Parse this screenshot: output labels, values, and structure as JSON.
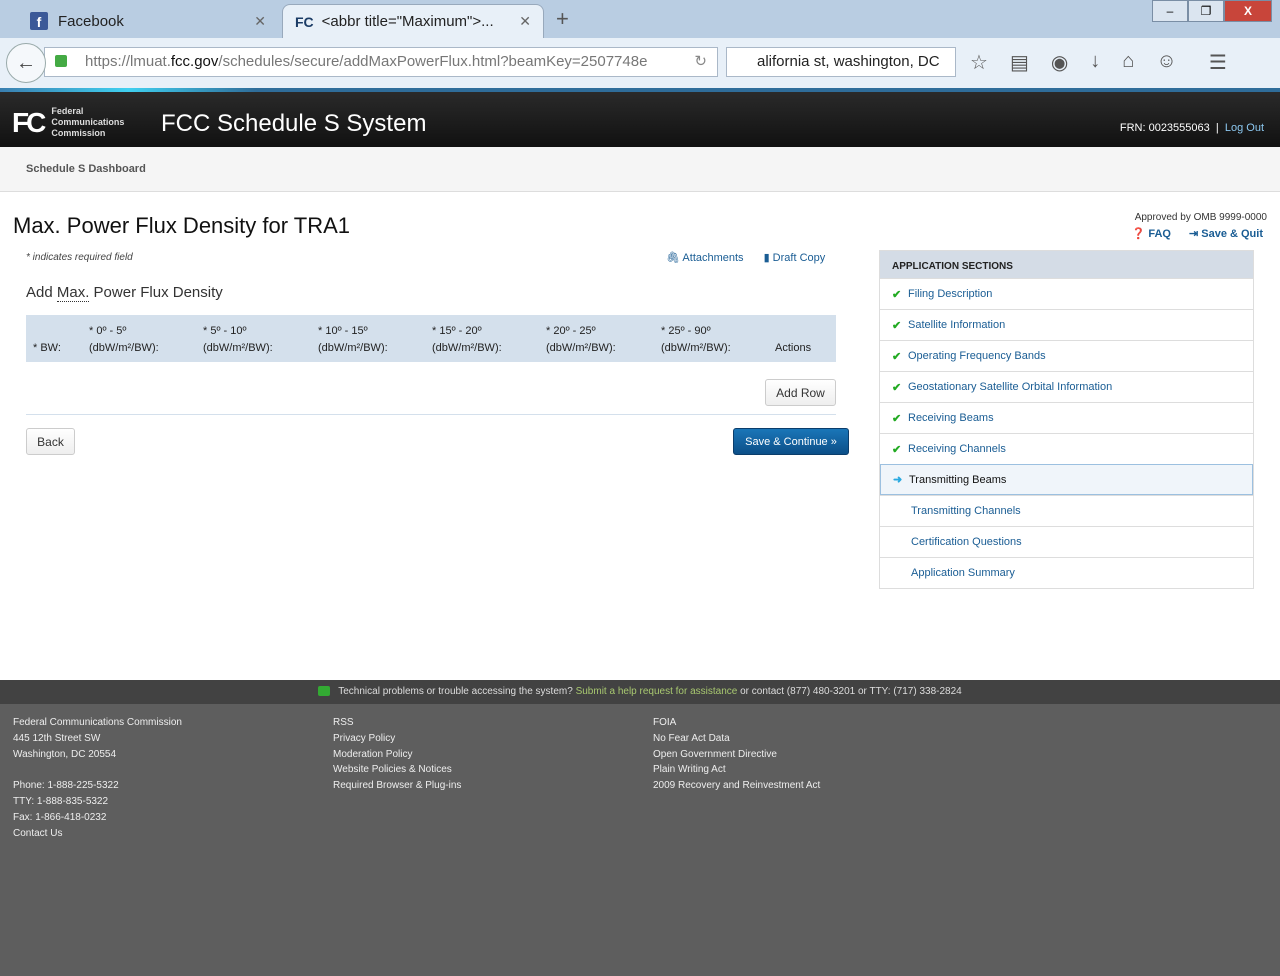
{
  "browser": {
    "tabs": [
      {
        "label": "Facebook"
      },
      {
        "label": "<abbr title=\"Maximum\">..."
      }
    ],
    "url_prefix": "https://lmuat.",
    "url_domain": "fcc.gov",
    "url_path": "/schedules/secure/addMaxPowerFlux.html?beamKey=2507748e",
    "search_value": "alifornia st, washington, DC"
  },
  "header": {
    "logo_text": "Federal Communications Commission",
    "app_title": "FCC Schedule S System",
    "frn": "FRN: 0023555063",
    "logout": "Log Out"
  },
  "subnav": {
    "dashboard": "Schedule S Dashboard"
  },
  "page": {
    "title": "Max. Power Flux Density for TRA1",
    "required_note": "* indicates required field",
    "attachments": "Attachments",
    "draft_copy": "Draft Copy",
    "section_title_abbr": "Max.",
    "section_title_rest": " Power Flux Density",
    "section_title_prefix": "Add ",
    "columns": [
      {
        "top": "",
        "bottom": "* BW:"
      },
      {
        "top": "* 0º - 5º",
        "bottom": "(dbW/m²/BW):"
      },
      {
        "top": "* 5º - 10º",
        "bottom": "(dbW/m²/BW):"
      },
      {
        "top": "* 10º - 15º",
        "bottom": "(dbW/m²/BW):"
      },
      {
        "top": "* 15º - 20º",
        "bottom": "(dbW/m²/BW):"
      },
      {
        "top": "* 20º - 25º",
        "bottom": "(dbW/m²/BW):"
      },
      {
        "top": "* 25º - 90º",
        "bottom": "(dbW/m²/BW):"
      },
      {
        "top": "",
        "bottom": "Actions"
      }
    ],
    "add_row": "Add Row",
    "back": "Back",
    "save_continue": "Save & Continue »"
  },
  "sidebar": {
    "approved": "Approved by OMB 9999-0000",
    "faq": "FAQ",
    "save_quit": "Save & Quit",
    "heading": "APPLICATION SECTIONS",
    "items": [
      {
        "label": "Filing Description",
        "status": "complete"
      },
      {
        "label": "Satellite Information",
        "status": "complete"
      },
      {
        "label": "Operating Frequency Bands",
        "status": "complete"
      },
      {
        "label": "Geostationary Satellite Orbital Information",
        "status": "complete"
      },
      {
        "label": "Receiving Beams",
        "status": "complete"
      },
      {
        "label": "Receiving Channels",
        "status": "complete"
      },
      {
        "label": "Transmitting Beams",
        "status": "current"
      },
      {
        "label": "Transmitting Channels",
        "status": "pending"
      },
      {
        "label": "Certification Questions",
        "status": "pending"
      },
      {
        "label": "Application Summary",
        "status": "pending"
      }
    ]
  },
  "helpbar": {
    "text1": "Technical problems or trouble accessing the system?",
    "link": "Submit a help request for assistance",
    "text2": " or contact (877) 480-3201 or TTY: (717) 338-2824"
  },
  "footer": {
    "col1": [
      "Federal Communications Commission",
      "445 12th Street SW",
      "Washington, DC 20554",
      "",
      "Phone: 1-888-225-5322",
      "TTY: 1-888-835-5322",
      "Fax: 1-866-418-0232",
      "Contact Us"
    ],
    "col2": [
      "RSS",
      "Privacy Policy",
      "Moderation Policy",
      "Website Policies & Notices",
      "Required Browser & Plug-ins"
    ],
    "col3": [
      "FOIA",
      "No Fear Act Data",
      "Open Government Directive",
      "Plain Writing Act",
      "2009 Recovery and Reinvestment Act"
    ]
  }
}
